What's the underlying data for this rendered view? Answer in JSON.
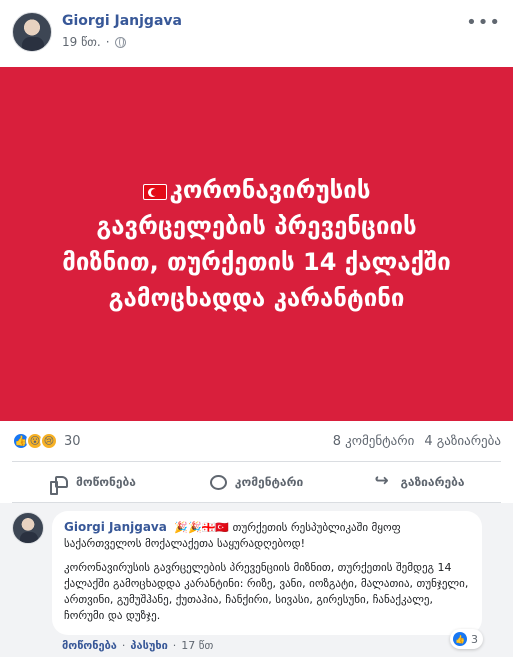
{
  "post": {
    "author": "Giorgi Janjgava",
    "time": "19 წთ.",
    "separator": "·",
    "privacy_icon": "globe-icon",
    "more_icon": "ellipsis-icon",
    "image_text": "კორონავირუსის გავრცელების პრევენციის მიზნით, თურქეთის 14 ქალაქში გამოცხადდა კარანტინი",
    "image_bg": "#d91f3c"
  },
  "stats": {
    "reaction_count": "30",
    "comments": "8 კომენტარი",
    "shares": "4 გაზიარება",
    "reaction_icons": [
      "like-icon",
      "wow-icon",
      "sad-icon"
    ]
  },
  "actions": {
    "like": "მოწონება",
    "comment": "კომენტარი",
    "share": "გაზიარება"
  },
  "comment": {
    "author": "Giorgi Janjgava",
    "emojis": "🎉🎉🇬🇪🇹🇷",
    "line1": "თურქეთის რესპუბლიკაში მყოფ საქართველოს მოქალაქეთა საყურადღებოდ!",
    "line2": "კორონავირუსის გავრცელების პრევენციის მიზნით, თურქეთის შემდეგ 14 ქალაქში გამოცხადდა კარანტინი: რიზე, ვანი, იოზგატი, მალათია, თუნჯელი, ართვინი, გუმუშჰანე, ქუთაჰია, ჩანქირი, სივასი, გირესუნი, ჩანაქკალე, ჩორუმი და დუზჯე.",
    "react_count": "3",
    "like_action": "მოწონება",
    "reply_action": "პასუხი",
    "time": "17 წთ",
    "sep": "·"
  }
}
